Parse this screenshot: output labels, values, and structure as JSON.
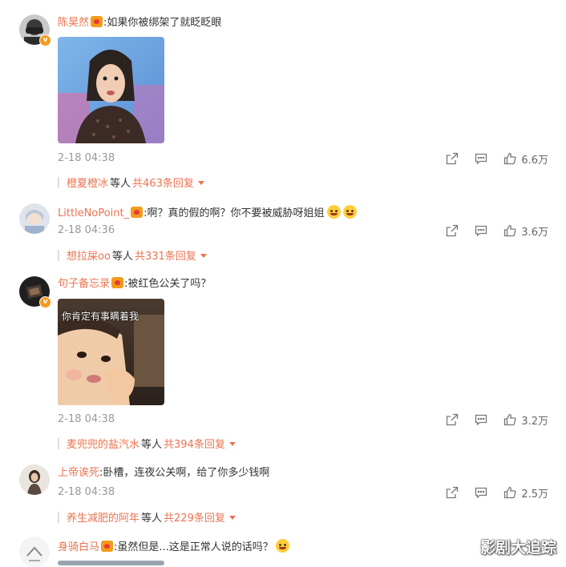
{
  "comments": [
    {
      "username": "陈昊然",
      "text": ":如果你被绑架了就眨眨眼",
      "time": "2-18 04:38",
      "likes": "6.6万",
      "reply_names": "橙夏橙冰",
      "reply_deng": "等人",
      "reply_count": "共463条回复"
    },
    {
      "username": "LittleNoPoint_",
      "text": ":啊？真的假的啊？你不要被威胁呀姐姐",
      "time": "2-18 04:36",
      "likes": "3.6万",
      "reply_names": "想拉屎oo",
      "reply_deng": "等人",
      "reply_count": "共331条回复"
    },
    {
      "username": "句子备忘录",
      "text": ":被红色公关了吗？",
      "image_caption": "你肯定有事瞒着我",
      "time": "2-18 04:38",
      "likes": "3.2万",
      "reply_names": "麦兜兜的盐汽水",
      "reply_deng": "等人",
      "reply_count": "共394条回复"
    },
    {
      "username": "上帝诶死",
      "text": ":卧槽，连夜公关啊，给了你多少钱啊",
      "time": "2-18 04:38",
      "likes": "2.5万",
      "reply_names": "养生减肥的阿年",
      "reply_deng": "等人",
      "reply_count": "共229条回复"
    },
    {
      "username": "身骑白马",
      "text": ":虽然但是...这是正常人说的话吗？"
    }
  ],
  "watermark": "影剧大追踪",
  "icons": {
    "share": "share-icon",
    "comment": "comment-icon",
    "like": "thumbs-up-icon"
  },
  "colors": {
    "username": "#eb7350",
    "meta": "#999999",
    "badge": "#f59a1e"
  }
}
